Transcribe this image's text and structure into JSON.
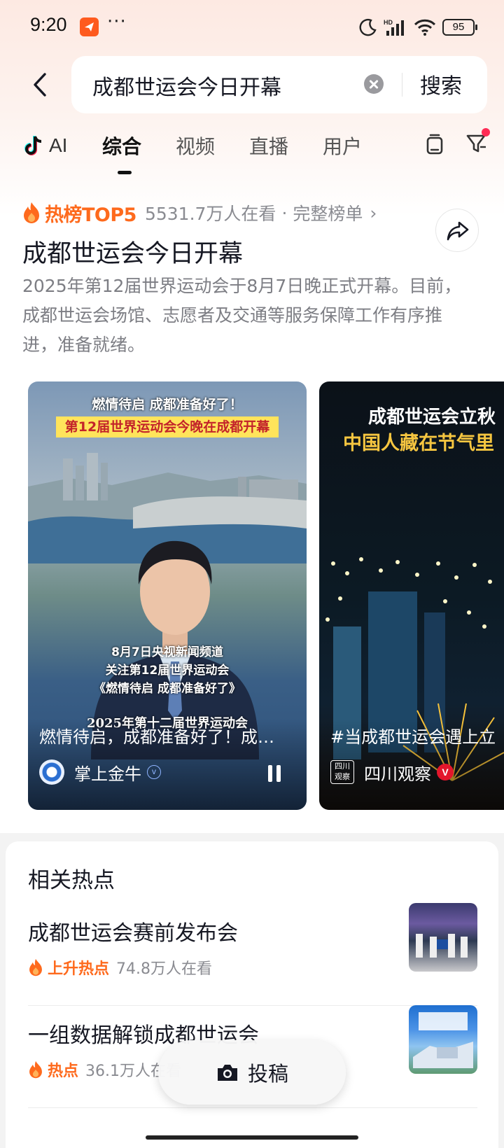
{
  "status_bar": {
    "time": "9:20",
    "dots": "···",
    "battery": "95",
    "icons": [
      "moon-icon",
      "hd-signal-icon",
      "wifi-icon",
      "battery-icon"
    ]
  },
  "search": {
    "query": "成都世运会今日开幕",
    "button": "搜索"
  },
  "tabs": {
    "ai_label": "AI",
    "items": [
      {
        "label": "综合",
        "active": true
      },
      {
        "label": "视频",
        "active": false
      },
      {
        "label": "直播",
        "active": false
      },
      {
        "label": "用户",
        "active": false
      }
    ]
  },
  "hot": {
    "label": "热榜TOP5",
    "views": "5531.7万人在看",
    "separator": "·",
    "full_list": "完整榜单",
    "chevron": "›",
    "title": "成都世运会今日开幕",
    "description": "2025年第12届世界运动会于8月7日晚正式开幕。目前，成都世运会场馆、志愿者及交通等服务保障工作有序推进，准备就绪。"
  },
  "videos": [
    {
      "overlay_title_1": "燃情待启 成都准备好了！",
      "overlay_title_2": "第12届世界运动会今晚在成都开幕",
      "overlay_sub_1": "8月7日央视新闻频道",
      "overlay_sub_2": "关注第12届世界运动会",
      "overlay_sub_3": "《燃情待启 成都准备好了》",
      "overlay_caption": "2025年第十二届世界运动会",
      "text": "燃情待启，成都准备好了！成…",
      "author": "掌上金牛",
      "verified_mark": "v"
    },
    {
      "overlay_title_1": "成都世运会立秋",
      "overlay_title_2": "中国人藏在节气里",
      "text": "#当成都世运会遇上立",
      "author": "四川观察",
      "logo_text": "四川观察",
      "verified_mark": "V"
    }
  ],
  "related": {
    "title": "相关热点",
    "items": [
      {
        "title": "成都世运会赛前发布会",
        "tag": "上升热点",
        "views": "74.8万人在看"
      },
      {
        "title": "一组数据解锁成都世运会",
        "tag": "热点",
        "views": "36.1万人在看"
      }
    ]
  },
  "post_button": {
    "label": "投稿"
  },
  "colors": {
    "accent": "#fe6a1d",
    "text": "#161823",
    "secondary": "#8a8b91"
  }
}
